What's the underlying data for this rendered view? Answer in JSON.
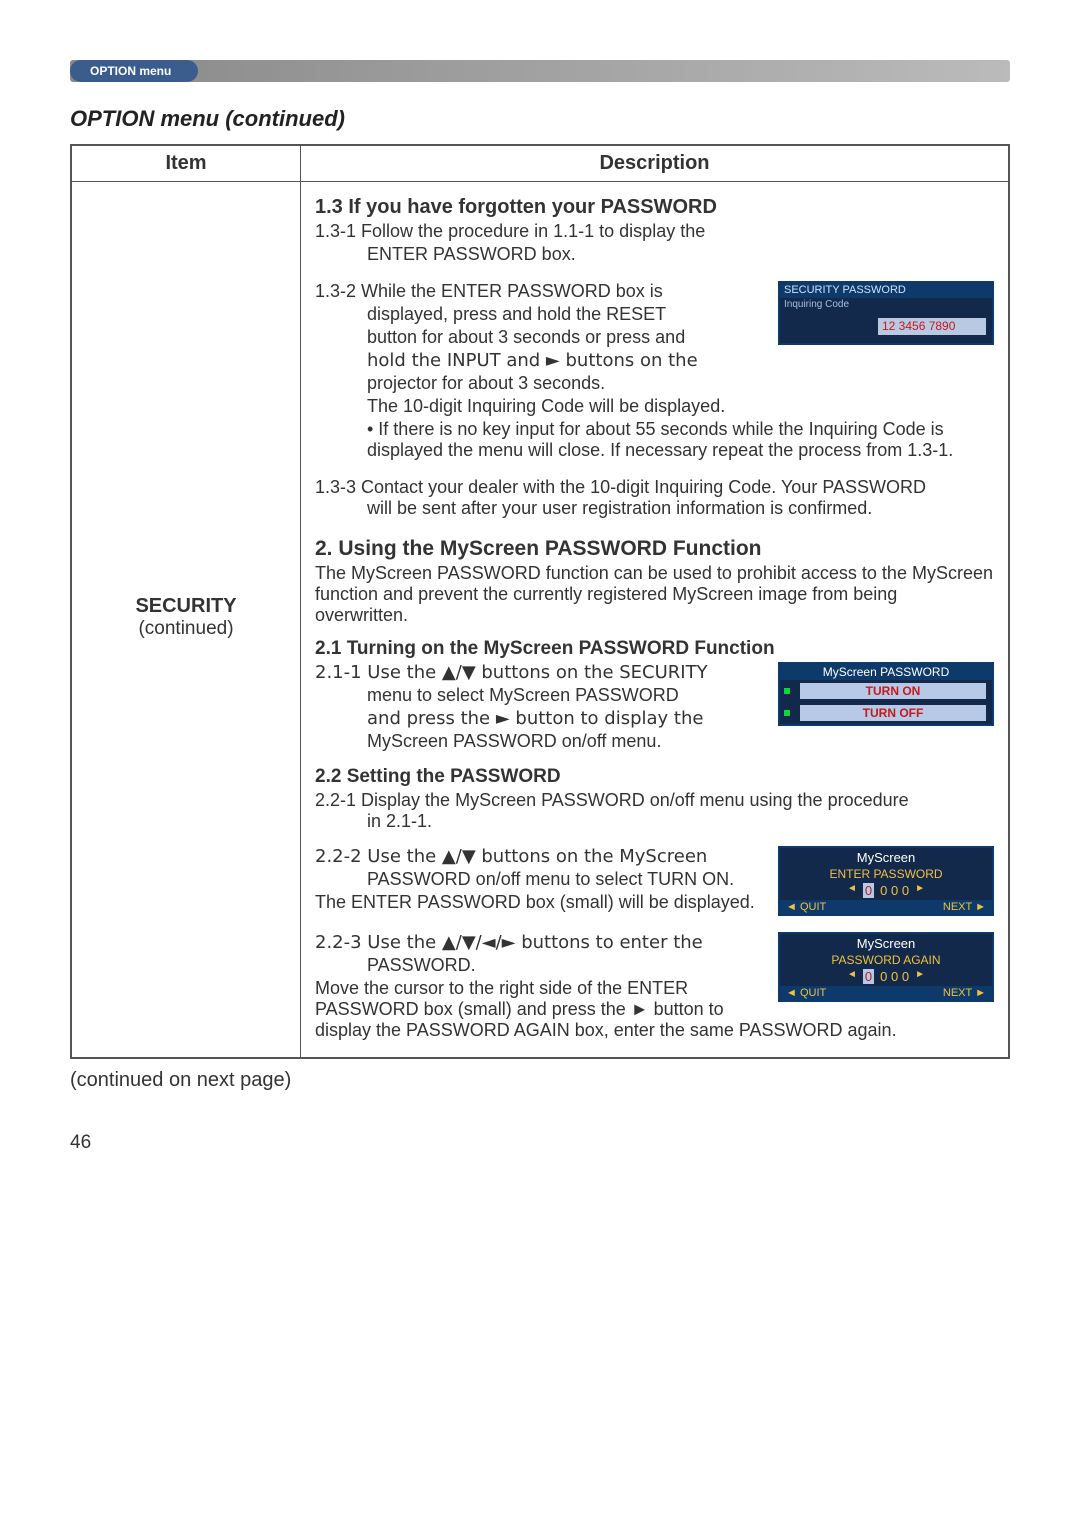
{
  "header": {
    "tab": "OPTION menu"
  },
  "section_title": "OPTION menu (continued)",
  "table": {
    "col_item": "Item",
    "col_desc": "Description",
    "item_label": "SECURITY",
    "item_sub": "(continued)"
  },
  "d": {
    "h13": "1.3 If you have forgotten your PASSWORD",
    "p131a": "1.3-1 Follow the procedure in 1.1-1 to display the",
    "p131b": "ENTER PASSWORD box.",
    "p132a": "1.3-2 While the ENTER PASSWORD box is",
    "p132b": "displayed, press and hold the RESET",
    "p132c": "button for about 3 seconds or press and",
    "p132d": "hold the INPUT and ► buttons on the",
    "p132e": "projector for about 3 seconds.",
    "p132f": "The 10-digit Inquiring Code will be displayed.",
    "p132g": "• If there is no key input for about 55 seconds while the Inquiring Code is displayed the menu will close. If necessary repeat the process from 1.3-1.",
    "p133": "1.3-3 Contact your dealer with the 10-digit Inquiring Code. Your PASSWORD will be sent after your user registration information is confirmed.",
    "h2": "2. Using the MyScreen PASSWORD Function",
    "p2": "The MyScreen PASSWORD function can be used to prohibit access to the MyScreen function and prevent the currently registered MyScreen image from being overwritten.",
    "h21": "2.1 Turning on the MyScreen PASSWORD Function",
    "p211a": "2.1-1 Use the ▲/▼ buttons on the SECURITY",
    "p211b": "menu to select MyScreen PASSWORD",
    "p211c": "and press the ► button to display the",
    "p211d": "MyScreen PASSWORD on/off menu.",
    "h22": "2.2 Setting the PASSWORD",
    "p221": "2.2-1 Display the MyScreen PASSWORD on/off menu using the procedure in 2.1-1.",
    "p222a": "2.2-2 Use the ▲/▼ buttons on the MyScreen",
    "p222b": "PASSWORD on/off menu to select TURN ON.",
    "p222c": "The ENTER PASSWORD box (small) will be displayed.",
    "p223a": "2.2-3 Use the ▲/▼/◄/► buttons to enter the",
    "p223b": "PASSWORD.",
    "p223c": "Move the cursor to the right side of the ENTER PASSWORD box (small) and press the ► button to display the PASSWORD AGAIN box, enter the same PASSWORD again."
  },
  "osd1": {
    "title": "SECURITY PASSWORD",
    "sub": "Inquiring Code",
    "code": "12 3456 7890"
  },
  "osd2": {
    "title": "MyScreen PASSWORD",
    "on": "TURN ON",
    "off": "TURN OFF"
  },
  "osd3": {
    "title": "MyScreen",
    "sub": "ENTER PASSWORD",
    "d0": "0",
    "dz": "0 0 0",
    "quit": "◄ QUIT",
    "next": "NEXT ►"
  },
  "osd4": {
    "title": "MyScreen",
    "sub": "PASSWORD AGAIN",
    "d0": "0",
    "dz": "0 0 0",
    "quit": "◄ QUIT",
    "next": "NEXT ►"
  },
  "footer": {
    "cont": "(continued on next page)",
    "page_num": "46"
  }
}
